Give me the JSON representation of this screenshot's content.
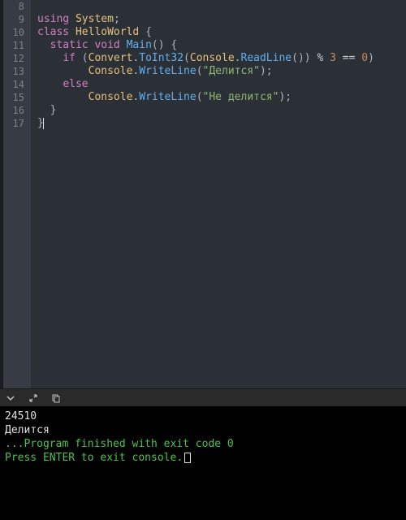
{
  "editor": {
    "startLine": 8,
    "lines": [
      {
        "num": 8,
        "tokens": []
      },
      {
        "num": 9,
        "tokens": [
          {
            "t": "kw",
            "v": "using"
          },
          {
            "t": "norm",
            "v": " "
          },
          {
            "t": "type",
            "v": "System"
          },
          {
            "t": "pun",
            "v": ";"
          }
        ]
      },
      {
        "num": 10,
        "fold": true,
        "tokens": [
          {
            "t": "kw",
            "v": "class"
          },
          {
            "t": "norm",
            "v": " "
          },
          {
            "t": "type",
            "v": "HelloWorld"
          },
          {
            "t": "norm",
            "v": " "
          },
          {
            "t": "pun",
            "v": "{"
          }
        ]
      },
      {
        "num": 11,
        "tokens": [
          {
            "t": "norm",
            "v": "  "
          },
          {
            "t": "kw",
            "v": "static"
          },
          {
            "t": "norm",
            "v": " "
          },
          {
            "t": "kw",
            "v": "void"
          },
          {
            "t": "norm",
            "v": " "
          },
          {
            "t": "fn",
            "v": "Main"
          },
          {
            "t": "pun",
            "v": "() {"
          }
        ]
      },
      {
        "num": 12,
        "tokens": [
          {
            "t": "norm",
            "v": "    "
          },
          {
            "t": "kw",
            "v": "if"
          },
          {
            "t": "norm",
            "v": " "
          },
          {
            "t": "pun",
            "v": "("
          },
          {
            "t": "type",
            "v": "Convert"
          },
          {
            "t": "pun",
            "v": "."
          },
          {
            "t": "fn",
            "v": "ToInt32"
          },
          {
            "t": "pun",
            "v": "("
          },
          {
            "t": "type",
            "v": "Console"
          },
          {
            "t": "pun",
            "v": "."
          },
          {
            "t": "fn",
            "v": "ReadLine"
          },
          {
            "t": "pun",
            "v": "())"
          },
          {
            "t": "norm",
            "v": " "
          },
          {
            "t": "op",
            "v": "%"
          },
          {
            "t": "norm",
            "v": " "
          },
          {
            "t": "num",
            "v": "3"
          },
          {
            "t": "norm",
            "v": " "
          },
          {
            "t": "op",
            "v": "=="
          },
          {
            "t": "norm",
            "v": " "
          },
          {
            "t": "num",
            "v": "0"
          },
          {
            "t": "pun",
            "v": ")"
          }
        ]
      },
      {
        "num": 13,
        "tokens": [
          {
            "t": "norm",
            "v": "        "
          },
          {
            "t": "type",
            "v": "Console"
          },
          {
            "t": "pun",
            "v": "."
          },
          {
            "t": "fn",
            "v": "WriteLine"
          },
          {
            "t": "pun",
            "v": "("
          },
          {
            "t": "str",
            "v": "\"Делится\""
          },
          {
            "t": "pun",
            "v": ");"
          }
        ]
      },
      {
        "num": 14,
        "tokens": [
          {
            "t": "norm",
            "v": "    "
          },
          {
            "t": "kw",
            "v": "else"
          }
        ]
      },
      {
        "num": 15,
        "tokens": [
          {
            "t": "norm",
            "v": "        "
          },
          {
            "t": "type",
            "v": "Console"
          },
          {
            "t": "pun",
            "v": "."
          },
          {
            "t": "fn",
            "v": "WriteLine"
          },
          {
            "t": "pun",
            "v": "("
          },
          {
            "t": "str",
            "v": "\"Не делится\""
          },
          {
            "t": "pun",
            "v": ");"
          }
        ]
      },
      {
        "num": 16,
        "tokens": [
          {
            "t": "norm",
            "v": "  "
          },
          {
            "t": "pun",
            "v": "}"
          }
        ]
      },
      {
        "num": 17,
        "cursor": true,
        "tokens": [
          {
            "t": "pun",
            "v": "}"
          }
        ]
      }
    ]
  },
  "terminal": {
    "lines": [
      {
        "cls": "",
        "text": "24510"
      },
      {
        "cls": "",
        "text": "Делится"
      },
      {
        "cls": "",
        "text": ""
      },
      {
        "cls": "",
        "text": ""
      },
      {
        "cls": "term-green",
        "text": "...Program finished with exit code 0"
      },
      {
        "cls": "term-green",
        "text": "Press ENTER to exit console.",
        "cur": true
      }
    ]
  }
}
